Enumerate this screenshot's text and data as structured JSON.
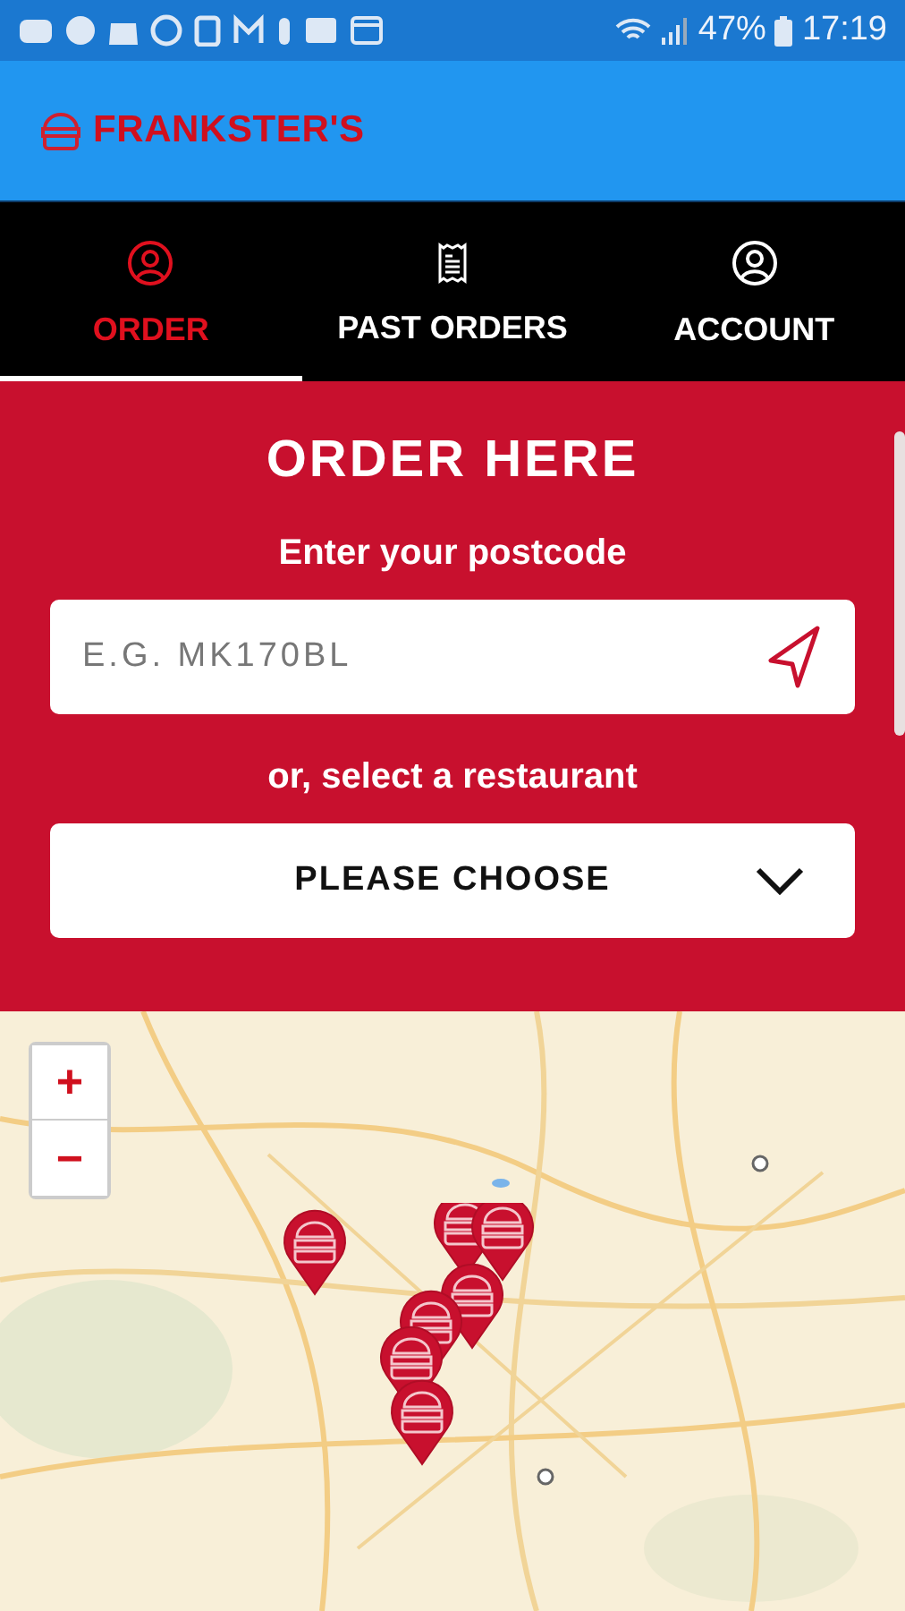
{
  "status_bar": {
    "battery": "47%",
    "time": "17:19"
  },
  "header": {
    "brand": "FRANKSTER'S"
  },
  "tabs": [
    {
      "label": "ORDER",
      "selected": true
    },
    {
      "label": "PAST ORDERS",
      "selected": false
    },
    {
      "label": "ACCOUNT",
      "selected": false
    }
  ],
  "order_panel": {
    "title": "ORDER HERE",
    "postcode_label": "Enter your postcode",
    "postcode": {
      "placeholder": "E.G. MK170BL"
    },
    "or_label": "or, select a restaurant",
    "restaurant_select": {
      "value": "PLEASE CHOOSE"
    }
  },
  "map": {
    "kind": "picture",
    "zoom_in": "+",
    "zoom_out": "−"
  }
}
